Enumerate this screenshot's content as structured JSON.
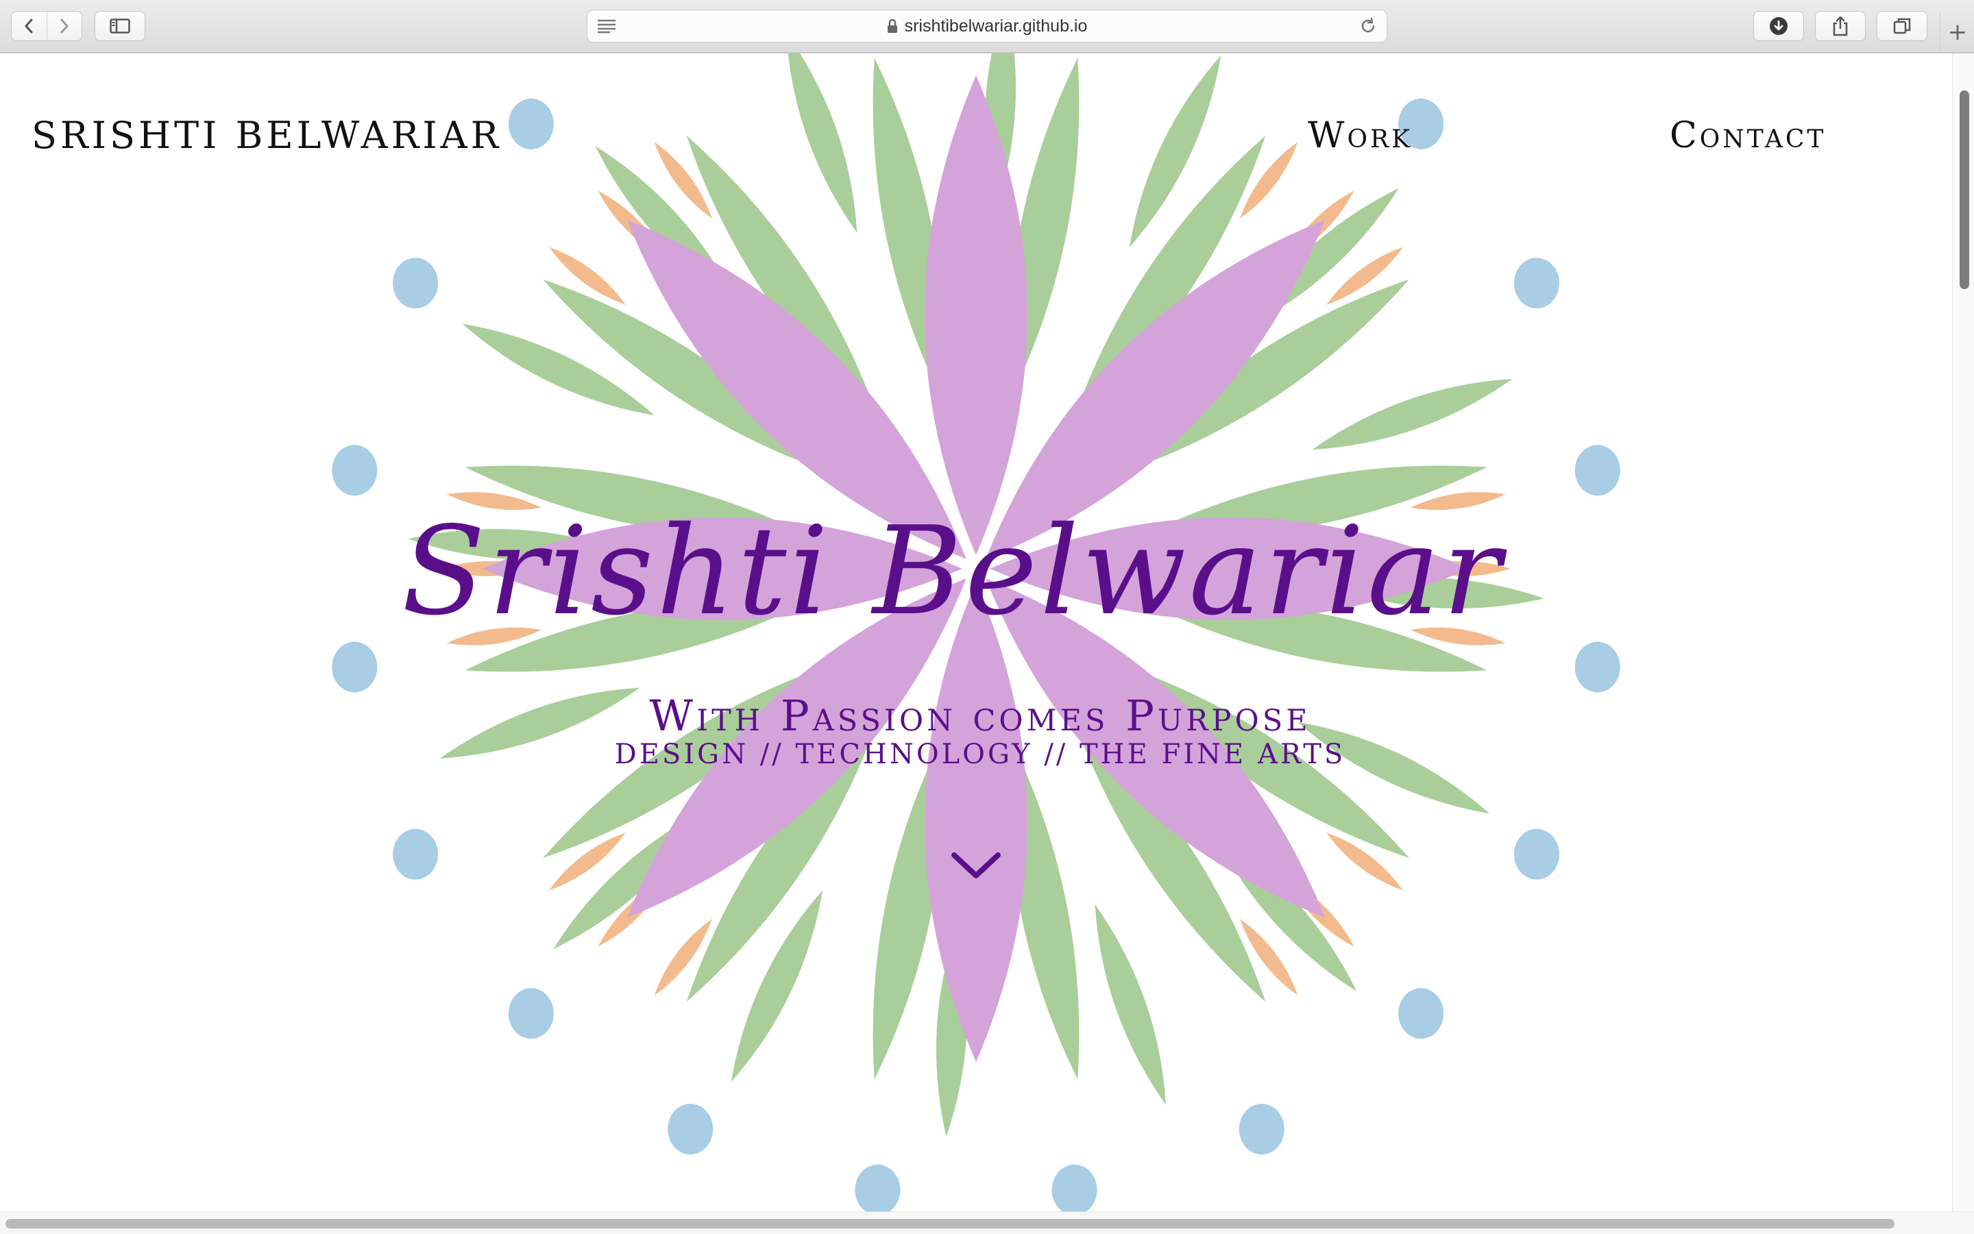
{
  "browser": {
    "url": "srishtibelwariar.github.io",
    "new_tab_label": "+",
    "icons": [
      "chevron-left-icon",
      "chevron-right-icon",
      "sidebar-icon",
      "reader-icon",
      "lock-icon",
      "reload-icon",
      "download-icon",
      "share-icon",
      "tabs-icon"
    ]
  },
  "site": {
    "brand": "SRISHTI BELWARIAR",
    "nav": {
      "work": "Work",
      "contact": "Contact"
    },
    "hero": {
      "title": "Srishti Belwariar",
      "tagline": "With Passion comes Purpose",
      "subline": "DESIGN // TECHNOLOGY // THE FINE ARTS",
      "scroll_icon": "chevron-down-icon"
    }
  },
  "colors": {
    "accent_purple": "#5a0f8a",
    "petal_purple": "#d4a3da",
    "leaf_green": "#a9ce9a",
    "leaf_orange": "#f3bb8d",
    "dot_blue": "#a8cde5"
  }
}
